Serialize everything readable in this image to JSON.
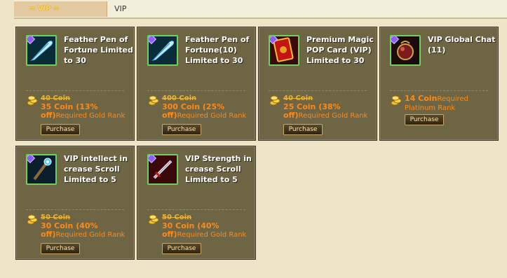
{
  "tabs": {
    "active_label": "= VIP =",
    "breadcrumb": "VIP"
  },
  "items": [
    {
      "name": "Feather Pen of Fortune Limited to 30",
      "old_price": "40 Coin",
      "sale_price": "35 Coin (13% off)",
      "requirement": "Required Gold Rank",
      "button": "Purchase",
      "icon": "feather-pen-icon"
    },
    {
      "name": "Feather Pen of Fortune(10) Limited to 30",
      "old_price": "400 Coin",
      "sale_price": "300 Coin (25% off)",
      "requirement": "Required Gold Rank",
      "button": "Purchase",
      "icon": "feather-pen-icon"
    },
    {
      "name": "Premium Magic POP Card (VIP) Limited to 30",
      "old_price": "40 Coin",
      "sale_price": "25 Coin (38% off)",
      "requirement": "Required Gold Rank",
      "button": "Purchase",
      "icon": "magic-card-icon"
    },
    {
      "name": "VIP Global Chat (11)",
      "sale_price": "14 Coin",
      "requirement": "Required Platinum Rank",
      "button": "Purchase",
      "icon": "chat-orb-icon"
    },
    {
      "name": "VIP intellect in crease Scroll Limited to 5",
      "old_price": "50 Coin",
      "sale_price": "30 Coin (40% off)",
      "requirement": "Required Gold Rank",
      "button": "Purchase",
      "icon": "staff-icon"
    },
    {
      "name": "VIP Strength in crease Scroll Limited to 5",
      "old_price": "50 Coin",
      "sale_price": "30 Coin (40% off)",
      "requirement": "Required Gold Rank",
      "button": "Purchase",
      "icon": "sword-icon"
    }
  ]
}
